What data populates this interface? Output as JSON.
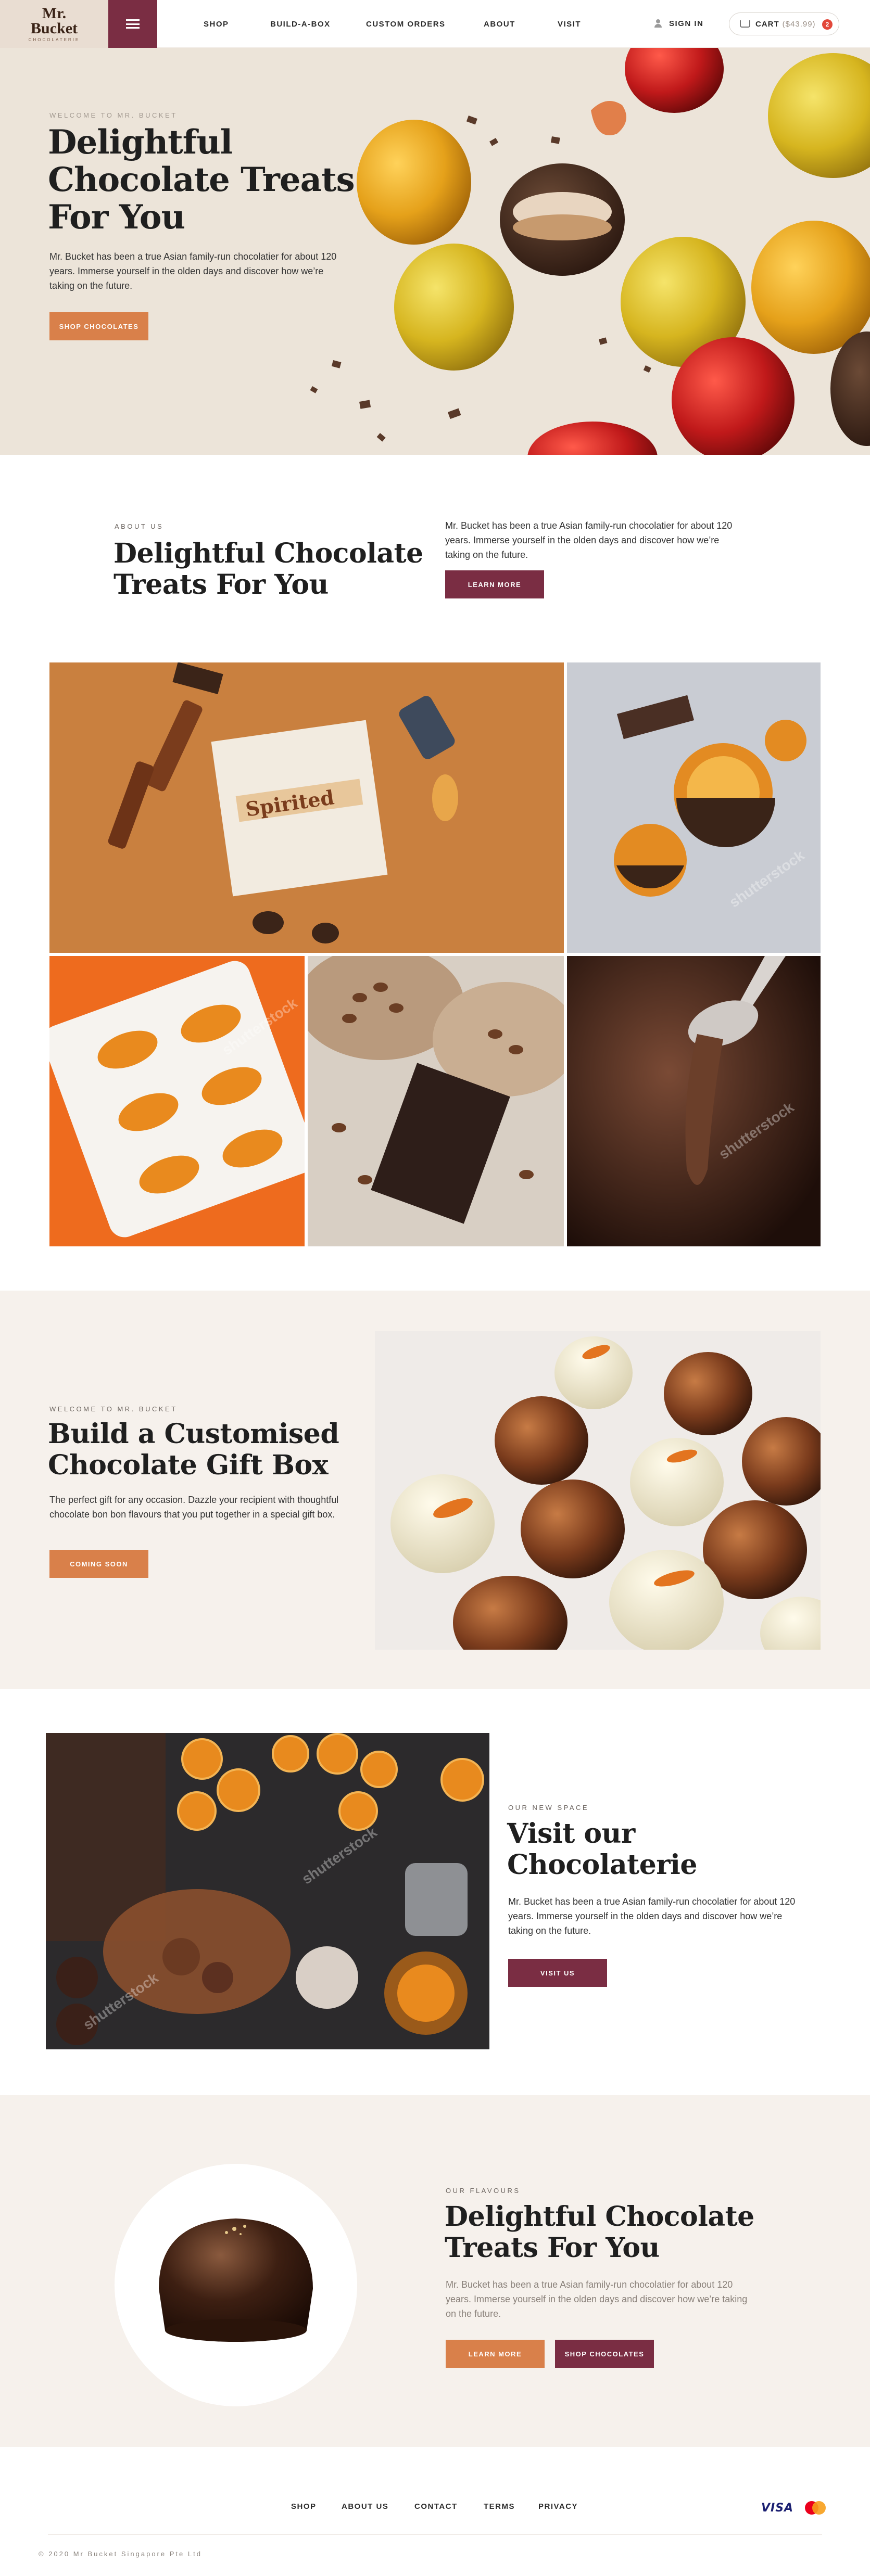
{
  "header": {
    "logo": {
      "line1": "Mr.",
      "line2": "Bucket",
      "tagline": "CHOCOLATERIE"
    },
    "nav": [
      {
        "label": "SHOP"
      },
      {
        "label": "BUILD-A-BOX"
      },
      {
        "label": "CUSTOM ORDERS"
      },
      {
        "label": "ABOUT"
      },
      {
        "label": "VISIT"
      }
    ],
    "sign_in": "SIGN IN",
    "cart": {
      "label": "CART",
      "amount": "($43.99)",
      "count": "2"
    }
  },
  "hero": {
    "eyebrow": "WELCOME TO MR. BUCKET",
    "title": "Delightful Chocolate Treats For You",
    "body": "Mr. Bucket has been a true Asian family-run chocolatier for about 120 years. Immerse yourself in the olden days and discover how we’re taking on the future.",
    "cta": "SHOP CHOCOLATES"
  },
  "about": {
    "eyebrow": "ABOUT US",
    "title": "Delightful Chocolate Treats For You",
    "body": "Mr. Bucket has been a true Asian family-run chocolatier for about 120 years. Immerse yourself in the olden days and discover how we’re taking on the future.",
    "cta": "LEARN MORE"
  },
  "gallery": {
    "spirited_label": "Spirited",
    "watermark": "shutterstock"
  },
  "gift": {
    "eyebrow": "WELCOME TO MR. BUCKET",
    "title": "Build a Customised Chocolate Gift Box",
    "body": "The perfect gift for any occasion. Dazzle your recipient with thoughtful chocolate bon bon flavours that you put together in a special gift box.",
    "cta": "COMING SOON"
  },
  "visit": {
    "eyebrow": "OUR NEW SPACE",
    "title": "Visit our Chocolaterie",
    "body": "Mr. Bucket has been a true Asian family-run chocolatier for about 120 years. Immerse yourself in the olden days and discover how we’re taking on the future.",
    "cta": "VISIT US"
  },
  "flavours": {
    "eyebrow": "OUR FLAVOURS",
    "title": "Delightful Chocolate Treats For You",
    "body": "Mr. Bucket has been a true Asian family-run chocolatier for about 120 years. Immerse yourself in the olden days and discover how we’re taking on the future.",
    "cta_primary": "LEARN MORE",
    "cta_secondary": "SHOP CHOCOLATES"
  },
  "footer": {
    "nav": [
      {
        "label": "SHOP"
      },
      {
        "label": "ABOUT US"
      },
      {
        "label": "CONTACT"
      },
      {
        "label": "TERMS"
      },
      {
        "label": "PRIVACY"
      }
    ],
    "payments": {
      "visa": "VISA"
    },
    "copyright": "© 2020 Mr Bucket Singapore Pte Ltd"
  },
  "colors": {
    "accent_plum": "#7a2d43",
    "accent_orange": "#d9804a",
    "hero_bg": "#ece4d9",
    "section_bg": "#f6f1ec"
  }
}
